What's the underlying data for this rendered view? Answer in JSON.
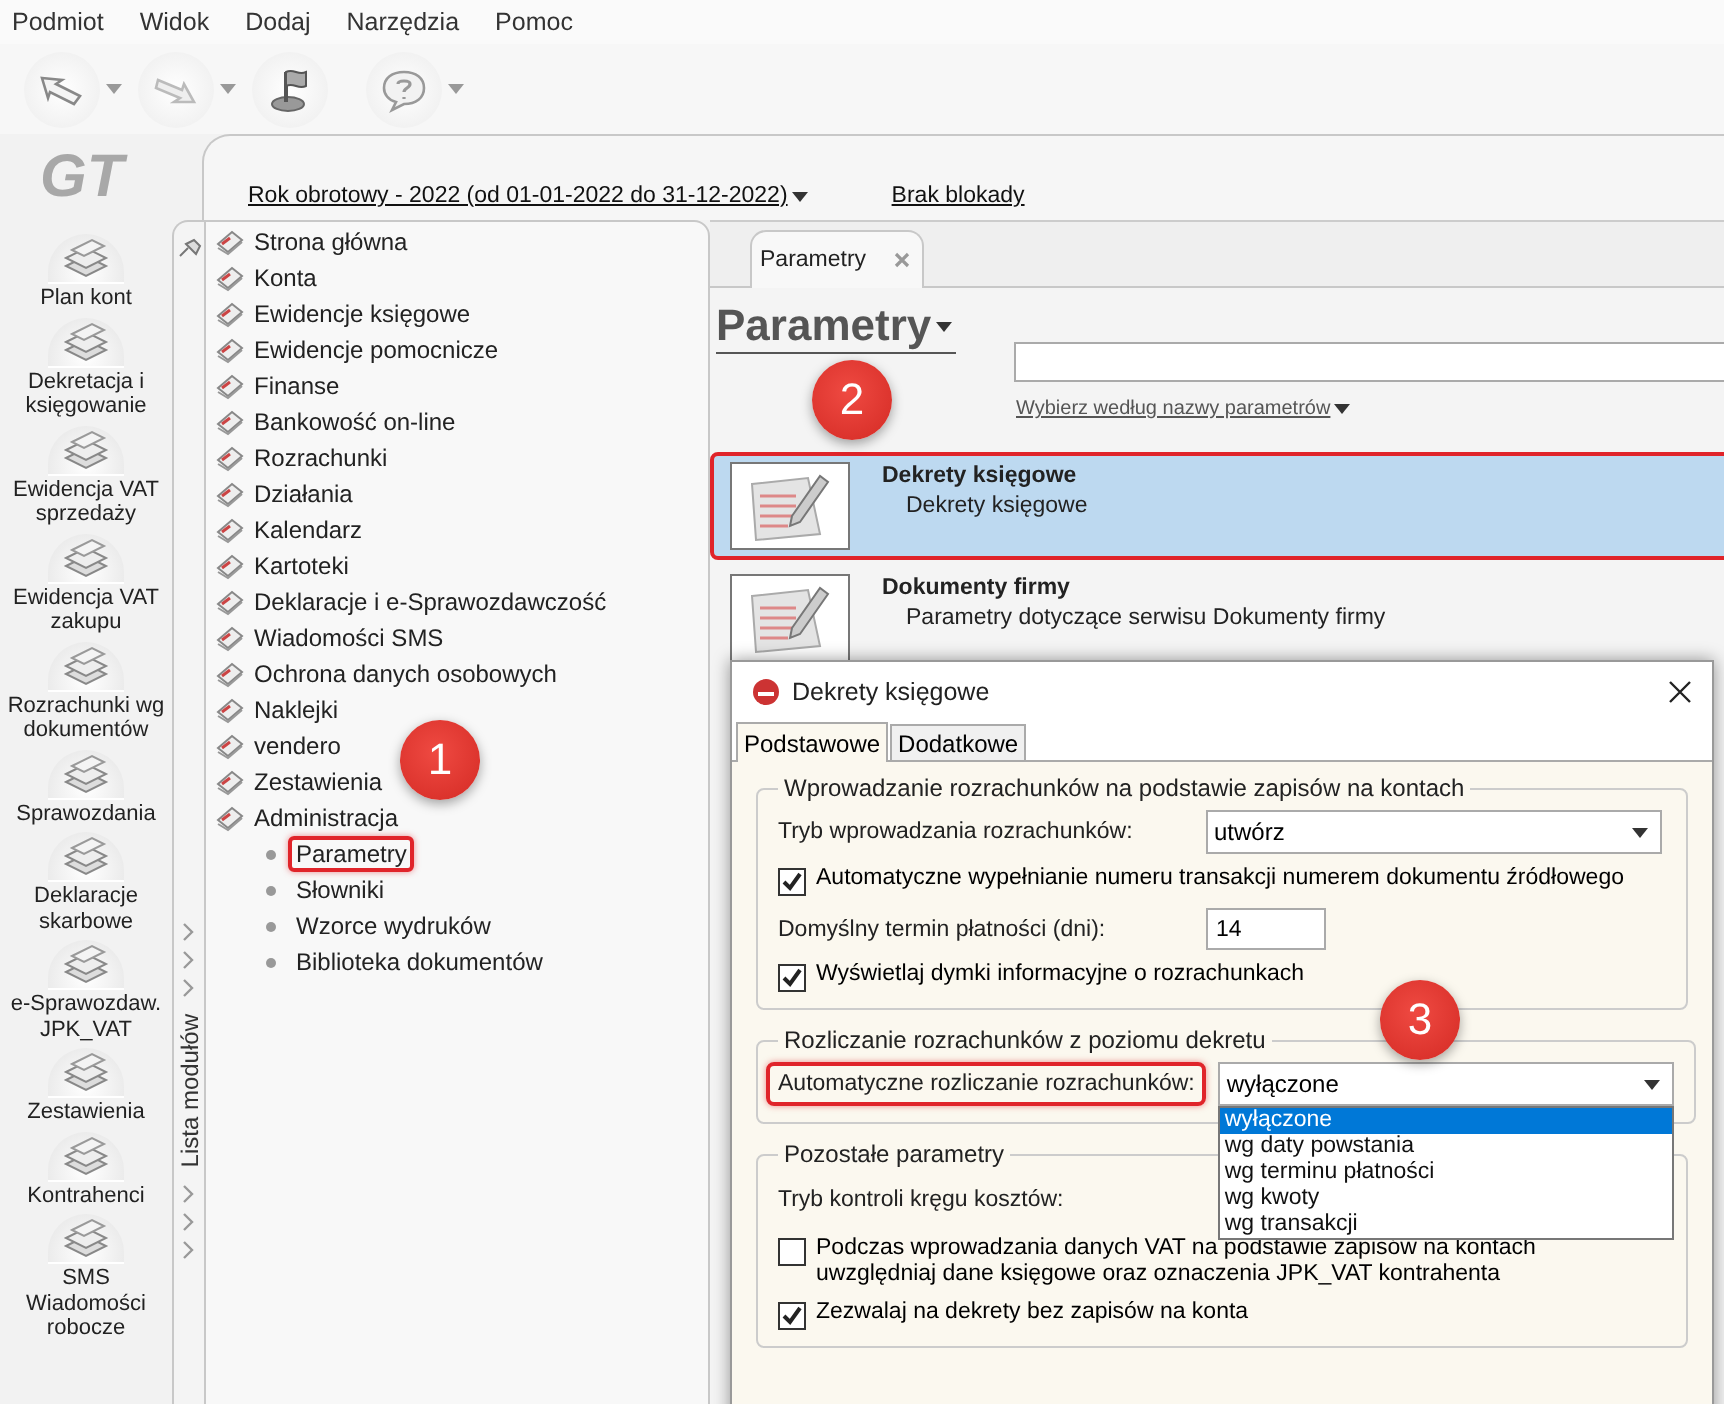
{
  "menu": [
    "Podmiot",
    "Widok",
    "Dodaj",
    "Narzędzia",
    "Pomoc"
  ],
  "toolbar": [
    {
      "kind": "arrow-left",
      "caret": true
    },
    {
      "kind": "arrow-right",
      "caret": true
    },
    {
      "kind": "flag",
      "caret": false
    },
    {
      "kind": "help",
      "caret": true
    }
  ],
  "logo": "GT",
  "nav": [
    "Plan kont",
    "Dekretacja i\nksięgowanie",
    "Ewidencja VAT\nsprzedaży",
    "Ewidencja VAT\nzakupu",
    "Rozrachunki wg\ndokumentów",
    "Sprawozdania",
    "Deklaracje\nskarbowe",
    "e-Sprawozdaw.\nJPK_VAT",
    "Zestawienia",
    "Kontrahenci",
    "SMS\nWiadomości\nrobocze"
  ],
  "period": "Rok obrotowy - 2022  (od 01-01-2022 do 31-12-2022)",
  "lock_status": "Brak blokady",
  "module_strip": "Lista modułów",
  "tree": [
    {
      "label": "Strona główna"
    },
    {
      "label": "Konta"
    },
    {
      "label": "Ewidencje księgowe"
    },
    {
      "label": "Ewidencje pomocnicze"
    },
    {
      "label": "Finanse"
    },
    {
      "label": "Bankowość on-line"
    },
    {
      "label": "Rozrachunki"
    },
    {
      "label": "Działania"
    },
    {
      "label": "Kalendarz"
    },
    {
      "label": "Kartoteki"
    },
    {
      "label": "Deklaracje i e-Sprawozdawczość"
    },
    {
      "label": "Wiadomości SMS"
    },
    {
      "label": "Ochrona danych osobowych"
    },
    {
      "label": "Naklejki"
    },
    {
      "label": "vendero"
    },
    {
      "label": "Zestawienia"
    },
    {
      "label": "Administracja",
      "children": [
        {
          "label": "Parametry",
          "highlighted": true
        },
        {
          "label": "Słowniki",
          "highlighted": false
        },
        {
          "label": "Wzorce wydruków",
          "highlighted": false
        },
        {
          "label": "Biblioteka dokumentów",
          "highlighted": false
        }
      ]
    }
  ],
  "tab": "Parametry",
  "page_title": "Parametry",
  "filter_link": "Wybierz według nazwy parametrów",
  "parameters": [
    {
      "title": "Dekrety księgowe",
      "description": "Dekrety księgowe",
      "selected": true,
      "highlighted": true
    },
    {
      "title": "Dokumenty firmy",
      "description": "Parametry dotyczące serwisu Dokumenty firmy",
      "selected": false,
      "highlighted": false
    }
  ],
  "dialog": {
    "title": "Dekrety księgowe",
    "tabs": [
      {
        "label": "Podstawowe",
        "selected": true
      },
      {
        "label": "Dodatkowe",
        "selected": false
      }
    ],
    "groups": [
      {
        "legend": "Wprowadzanie rozrachunków na podstawie zapisów na kontach",
        "rows": [
          {
            "kind": "select",
            "label": "Tryb wprowadzania rozrachunków:",
            "value": "utwórz"
          },
          {
            "kind": "checkbox",
            "label": "Automatyczne wypełnianie numeru transakcji numerem dokumentu źródłowego",
            "checked": true
          },
          {
            "kind": "number",
            "label": "Domyślny termin płatności (dni):",
            "value": "14"
          },
          {
            "kind": "checkbox",
            "label": "Wyświetlaj dymki informacyjne o rozrachunkach",
            "checked": true
          }
        ]
      },
      {
        "legend": "Rozliczanie rozrachunków z poziomu dekretu",
        "rows": [
          {
            "kind": "select",
            "label": "Automatyczne rozliczanie rozrachunków:",
            "value": "wyłączone",
            "highlighted": true,
            "expanded": true,
            "options": [
              {
                "label": "wyłączone",
                "selected": true
              },
              {
                "label": "wg daty powstania",
                "selected": false
              },
              {
                "label": "wg terminu płatności",
                "selected": false
              },
              {
                "label": "wg kwoty",
                "selected": false
              },
              {
                "label": "wg transakcji",
                "selected": false
              }
            ]
          }
        ]
      },
      {
        "legend": "Pozostałe parametry",
        "rows": [
          {
            "kind": "text",
            "label": "Tryb kontroli kręgu kosztów:"
          },
          {
            "kind": "checkbox",
            "label": "Podczas wprowadzania danych VAT na podstawie zapisów na kontach\nuwzględniaj dane księgowe oraz oznaczenia JPK_VAT kontrahenta",
            "checked": false
          },
          {
            "kind": "checkbox",
            "label": "Zezwalaj na dekrety bez zapisów na konta",
            "checked": true
          }
        ]
      }
    ]
  },
  "annotations": [
    "1",
    "2",
    "3"
  ]
}
